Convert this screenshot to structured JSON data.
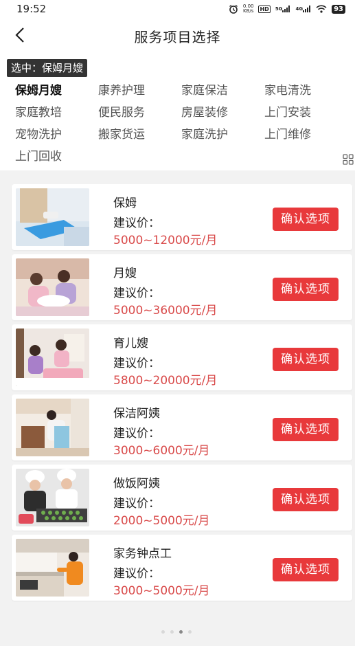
{
  "status": {
    "time": "19:52",
    "net_speed": "0.00\nKB/s",
    "hd_label": "HD",
    "signal1": "5G",
    "signal2": "4G",
    "battery": "93"
  },
  "header": {
    "title": "服务项目选择"
  },
  "selected": {
    "label": "选中：保姆月嫂"
  },
  "categories": [
    {
      "label": "保姆月嫂",
      "active": true
    },
    {
      "label": "康养护理"
    },
    {
      "label": "家庭保洁"
    },
    {
      "label": "家电清洗"
    },
    {
      "label": "家庭教培"
    },
    {
      "label": "便民服务"
    },
    {
      "label": "房屋装修"
    },
    {
      "label": "上门安装"
    },
    {
      "label": "宠物洗护"
    },
    {
      "label": "搬家货运"
    },
    {
      "label": "家庭洗护"
    },
    {
      "label": "上门维修"
    },
    {
      "label": "上门回收"
    }
  ],
  "services": [
    {
      "name": "保姆",
      "price_label": "建议价：",
      "price": "5000~12000元/月",
      "button": "确认选项",
      "image": "ironing-photo"
    },
    {
      "name": "月嫂",
      "price_label": "建议价：",
      "price": "5000~36000元/月",
      "button": "确认选项",
      "image": "newborn-care-photo"
    },
    {
      "name": "育儿嫂",
      "price_label": "建议价：",
      "price": "5800~20000元/月",
      "button": "确认选项",
      "image": "childcare-photo"
    },
    {
      "name": "保洁阿姨",
      "price_label": "建议价：",
      "price": "3000~6000元/月",
      "button": "确认选项",
      "image": "cleaning-photo"
    },
    {
      "name": "做饭阿姨",
      "price_label": "建议价：",
      "price": "2000~5000元/月",
      "button": "确认选项",
      "image": "chef-photo"
    },
    {
      "name": "家务钟点工",
      "price_label": "建议价：",
      "price": "3000~5000元/月",
      "button": "确认选项",
      "image": "kitchen-cleaning-photo"
    }
  ],
  "pager": {
    "total": 4,
    "current": 3
  },
  "colors": {
    "accent": "#e8393b",
    "price": "#d94a4a"
  }
}
